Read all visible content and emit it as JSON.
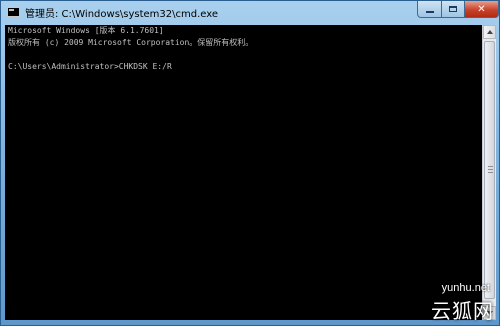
{
  "window": {
    "title": "管理员: C:\\Windows\\system32\\cmd.exe"
  },
  "console": {
    "lines": [
      "Microsoft Windows [版本 6.1.7601]",
      "版权所有 (c) 2009 Microsoft Corporation。保留所有权利。",
      "",
      "C:\\Users\\Administrator>CHKDSK E:/R"
    ],
    "text_color": "#c0c0c0",
    "background": "#000000"
  },
  "watermark": {
    "url": "yunhu.net",
    "brand": "云狐网"
  },
  "icons": {
    "app": "cmd-icon",
    "minimize": "minimize-icon",
    "maximize": "maximize-icon",
    "close": "close-icon"
  }
}
